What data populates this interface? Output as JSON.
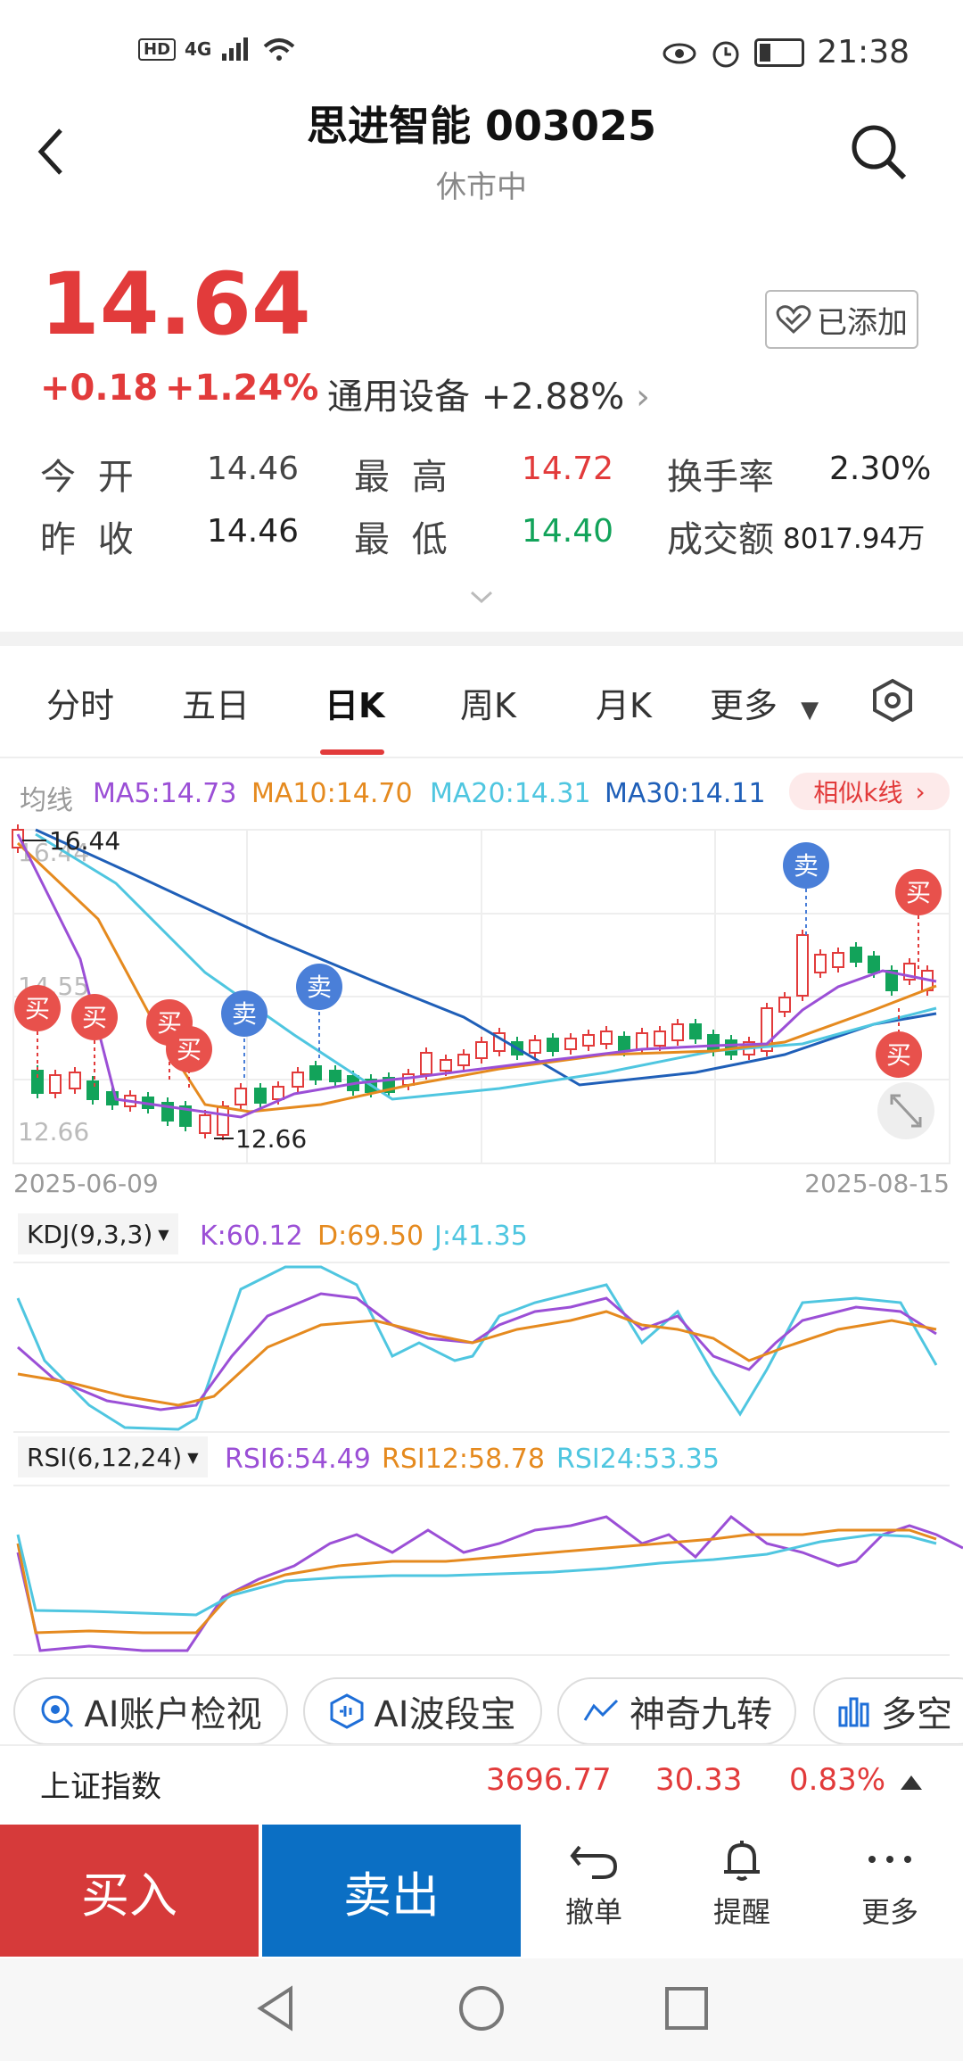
{
  "status": {
    "net": "4G",
    "time": "21:38"
  },
  "header": {
    "title": "思进智能 003025",
    "subtitle": "休市中"
  },
  "quote": {
    "price": "14.64",
    "change": "+0.18",
    "change_pct": "+1.24%",
    "sector": "通用设备 +2.88%",
    "added_label": "已添加",
    "stats": [
      {
        "label": "今 开",
        "value": "14.46"
      },
      {
        "label": "最 高",
        "value": "14.72"
      },
      {
        "label": "换手率",
        "value": "2.30%"
      },
      {
        "label": "昨 收",
        "value": "14.46"
      },
      {
        "label": "最 低",
        "value": "14.40"
      },
      {
        "label": "成交额",
        "value": "8017.94万"
      }
    ]
  },
  "tabs": [
    "分时",
    "五日",
    "日K",
    "周K",
    "月K",
    "更多"
  ],
  "ma_legend": {
    "title": "均线",
    "ma5": "MA5:14.73",
    "ma10": "MA10:14.70",
    "ma20": "MA20:14.31",
    "ma30": "MA30:14.11",
    "similar": "相似k线"
  },
  "kchart": {
    "y_top": "16.44",
    "y_mid": "14.55",
    "y_bottom": "12.66",
    "max_label": "16.44",
    "min_label": "12.66",
    "date_start": "2025-06-09",
    "date_end": "2025-08-15",
    "buy_label": "买",
    "sell_label": "卖"
  },
  "kdj": {
    "name": "KDJ(9,3,3)",
    "k": "K:60.12",
    "d": "D:69.50",
    "j": "J:41.35"
  },
  "rsi": {
    "name": "RSI(6,12,24)",
    "r6": "RSI6:54.49",
    "r12": "RSI12:58.78",
    "r24": "RSI24:53.35"
  },
  "features": [
    "AI账户检视",
    "AI波段宝",
    "神奇九转",
    "多空"
  ],
  "index": {
    "name": "上证指数",
    "value": "3696.77",
    "change": "30.33",
    "pct": "0.83%"
  },
  "actions": {
    "buy": "买入",
    "sell": "卖出",
    "cancel": "撤单",
    "alert": "提醒",
    "more": "更多"
  },
  "colors": {
    "up": "#e23b3b",
    "down": "#12a35a",
    "ma5": "#9b4fd6",
    "ma10": "#e58a1f",
    "ma20": "#4fc6e0",
    "ma30": "#1f5fb8",
    "sell_blue": "#0b6fc4"
  }
}
